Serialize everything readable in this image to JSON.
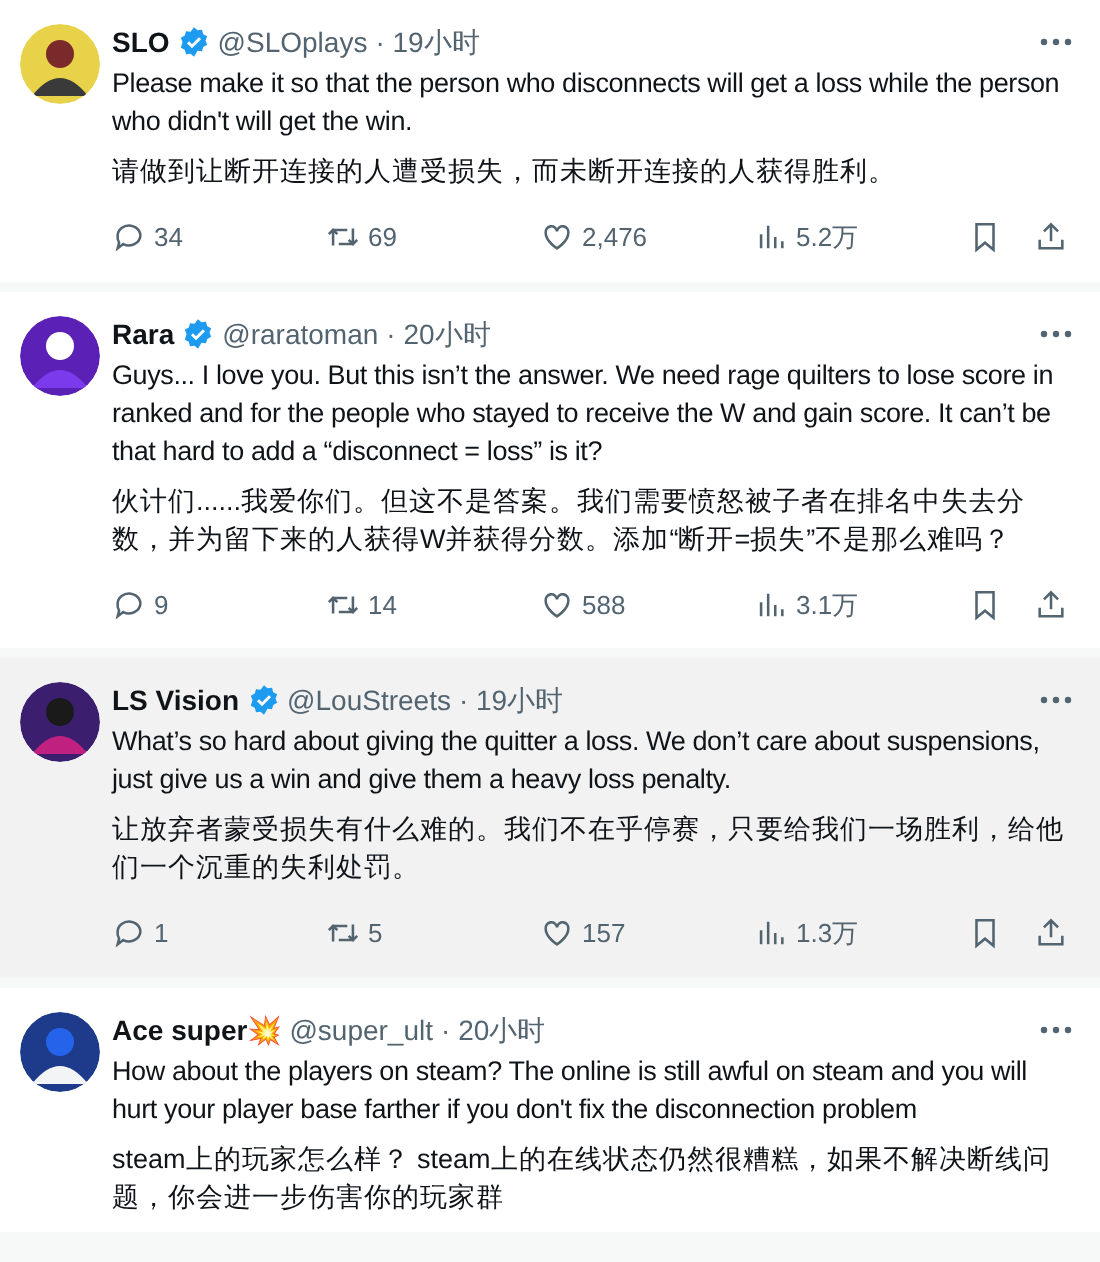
{
  "tweets": [
    {
      "name": "SLO",
      "verified": true,
      "handle": "@SLOplays",
      "time": "· 19小时",
      "text": "Please make it so that the person who disconnects will get a loss while the person who didn't will get the win.",
      "translation": "请做到让断开连接的人遭受损失，而未断开连接的人获得胜利。",
      "replies": "34",
      "reposts": "69",
      "likes": "2,476",
      "views": "5.2万",
      "highlighted": false
    },
    {
      "name": "Rara",
      "verified": true,
      "handle": "@raratoman",
      "time": "· 20小时",
      "text": "Guys... I love you. But this isn’t the answer. We need rage quilters to lose score in ranked and for the people who stayed to receive the W and gain score. It can’t be that hard to add a “disconnect = loss” is it?",
      "translation": "伙计们......我爱你们。但这不是答案。我们需要愤怒被子者在排名中失去分数，并为留下来的人获得W并获得分数。添加“断开=损失”不是那么难吗？",
      "replies": "9",
      "reposts": "14",
      "likes": "588",
      "views": "3.1万",
      "highlighted": false
    },
    {
      "name": "LS Vision",
      "verified": true,
      "handle": "@LouStreets",
      "time": "· 19小时",
      "text": "What’s so hard about giving the quitter a loss. We don’t care about suspensions, just give us a win and give them a heavy loss penalty.",
      "translation": "让放弃者蒙受损失有什么难的。我们不在乎停赛，只要给我们一场胜利，给他们一个沉重的失利处罚。",
      "replies": "1",
      "reposts": "5",
      "likes": "157",
      "views": "1.3万",
      "highlighted": true
    },
    {
      "name": "Ace super💥",
      "verified": false,
      "handle": "@super_ult",
      "time": "· 20小时",
      "text": "How about the players on steam? The online is still awful on steam and you will hurt your player base farther if you don't fix the disconnection problem",
      "translation": "steam上的玩家怎么样？ steam上的在线状态仍然很糟糕，如果不解决断线问题，你会进一步伤害你的玩家群",
      "highlighted": false
    }
  ]
}
